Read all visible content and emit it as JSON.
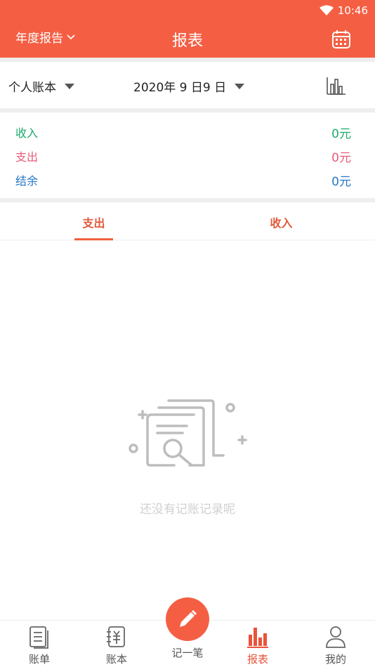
{
  "status_bar": {
    "time": "10:46"
  },
  "header": {
    "left_label": "年度报告",
    "title": "报表"
  },
  "filters": {
    "book": "个人账本",
    "date": "2020年 9 日9 日"
  },
  "summary": {
    "income_label": "收入",
    "income_value": "0元",
    "expense_label": "支出",
    "expense_value": "0元",
    "balance_label": "结余",
    "balance_value": "0元"
  },
  "tabs": {
    "expense": "支出",
    "income": "收入"
  },
  "empty_state": {
    "text": "还没有记账记录呢"
  },
  "bottom_nav": {
    "bills": "账单",
    "books": "账本",
    "record": "记一笔",
    "reports": "报表",
    "mine": "我的"
  },
  "colors": {
    "primary": "#f45f44",
    "income": "#1aab6a",
    "expense": "#e85a78",
    "balance": "#2577c7"
  },
  "icons": [
    "wifi-icon",
    "chevron-down-icon",
    "calendar-icon",
    "bar-chart-icon",
    "empty-document-search-icon",
    "bill-list-icon",
    "ledger-icon",
    "pencil-icon",
    "report-chart-icon",
    "user-icon"
  ]
}
